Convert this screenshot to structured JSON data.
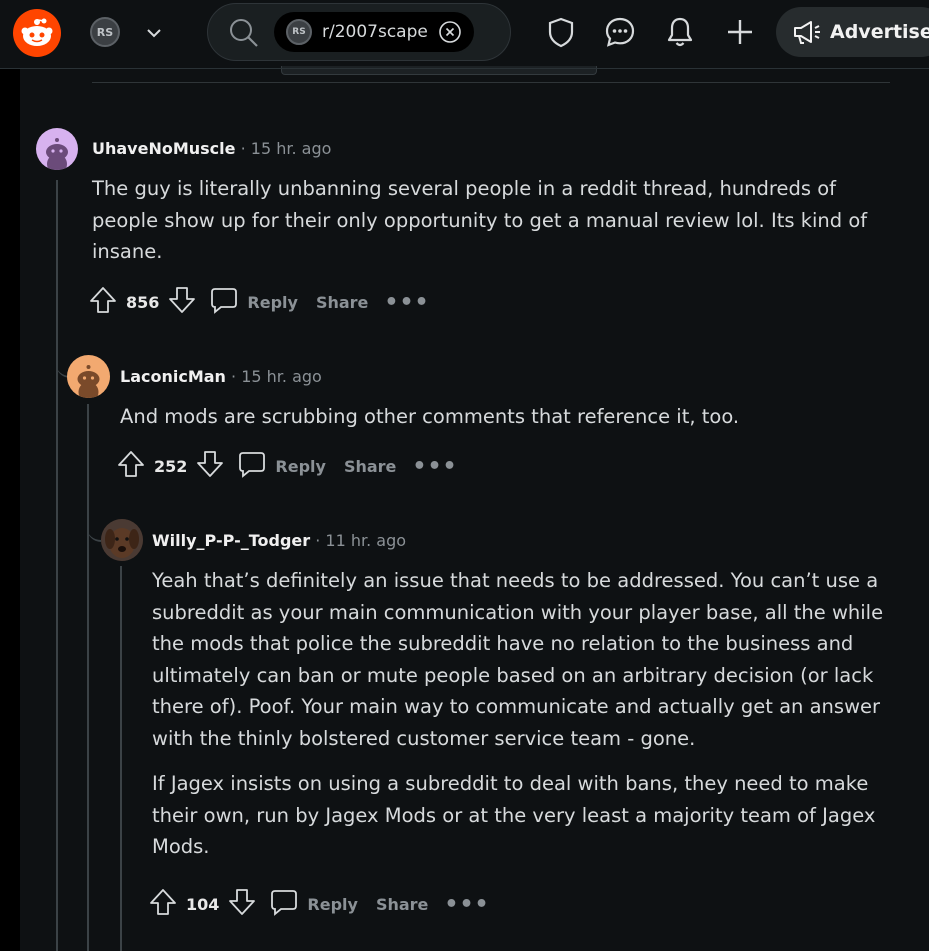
{
  "header": {
    "search_chip": "r/2007scape",
    "advertise_label": "Advertise",
    "subreddit_icon_text": "RS"
  },
  "colors": {
    "reddit_orange": "#ff4500",
    "background": "#0e1113"
  },
  "comments": [
    {
      "author": "UhaveNoMuscle",
      "time": "15 hr. ago",
      "body": [
        "The guy is literally unbanning several people in a reddit thread, hundreds of people show up for their only opportunity to get a manual review lol. Its kind of insane."
      ],
      "votes": "856",
      "reply_label": "Reply",
      "share_label": "Share",
      "more_label": "•••"
    },
    {
      "author": "LaconicMan",
      "time": "15 hr. ago",
      "body": [
        "And mods are scrubbing other comments that reference it, too."
      ],
      "votes": "252",
      "reply_label": "Reply",
      "share_label": "Share",
      "more_label": "•••"
    },
    {
      "author": "Willy_P-P-_Todger",
      "time": "11 hr. ago",
      "body": [
        "Yeah that’s definitely an issue that needs to be addressed. You can’t use a subreddit as your main communication with your player base, all the while the mods that police the subreddit have no relation to the business and ultimately can ban or mute people based on an arbitrary decision (or lack there of). Poof. Your main way to communicate and actually get an answer with the thinly bolstered customer service team - gone.",
        "If Jagex insists on using a subreddit to deal with bans, they need to make their own, run by Jagex Mods or at the very least a majority team of Jagex Mods."
      ],
      "votes": "104",
      "reply_label": "Reply",
      "share_label": "Share",
      "more_label": "•••"
    }
  ],
  "meta_separator": "·",
  "icons": [
    "reddit-logo-icon",
    "chevron-down-icon",
    "search-icon",
    "clear-icon",
    "mod-shield-icon",
    "chat-icon",
    "bell-icon",
    "plus-icon",
    "megaphone-icon",
    "upvote-icon",
    "downvote-icon",
    "comment-icon"
  ]
}
